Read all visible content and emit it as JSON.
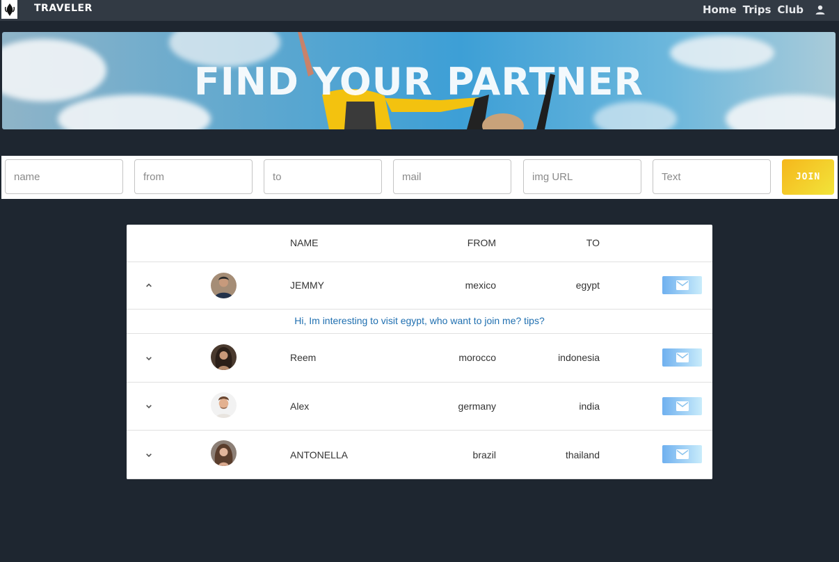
{
  "header": {
    "brand": "TRAVELER",
    "nav": [
      "Home",
      "Trips",
      "Club"
    ]
  },
  "hero": {
    "title": "FIND YOUR PARTNER"
  },
  "form": {
    "placeholders": {
      "name": "name",
      "from": "from",
      "to": "to",
      "mail": "mail",
      "img": "img URL",
      "text": "Text"
    },
    "join_label": "JOIN"
  },
  "table": {
    "columns": {
      "name": "NAME",
      "from": "FROM",
      "to": "TO"
    },
    "rows": [
      {
        "name": "JEMMY",
        "from": "mexico",
        "to": "egypt",
        "expanded": true,
        "message": "Hi, Im interesting to visit egypt, who want to join me? tips?"
      },
      {
        "name": "Reem",
        "from": "morocco",
        "to": "indonesia",
        "expanded": false
      },
      {
        "name": "Alex",
        "from": "germany",
        "to": "india",
        "expanded": false
      },
      {
        "name": "ANTONELLA",
        "from": "brazil",
        "to": "thailand",
        "expanded": false
      }
    ]
  },
  "colors": {
    "background": "#1e2630",
    "topbar": "#323a44",
    "join_gradient": [
      "#f5b71c",
      "#f2e43a"
    ],
    "mail_gradient": [
      "#6fb0ef",
      "#c9ecfb"
    ],
    "detail_text": "#1f6fb0"
  },
  "icons": {
    "logo": "traveler-logo-icon",
    "user": "account-icon",
    "expand": "chevron-down-icon",
    "collapse": "chevron-up-icon",
    "mail": "mail-icon"
  }
}
